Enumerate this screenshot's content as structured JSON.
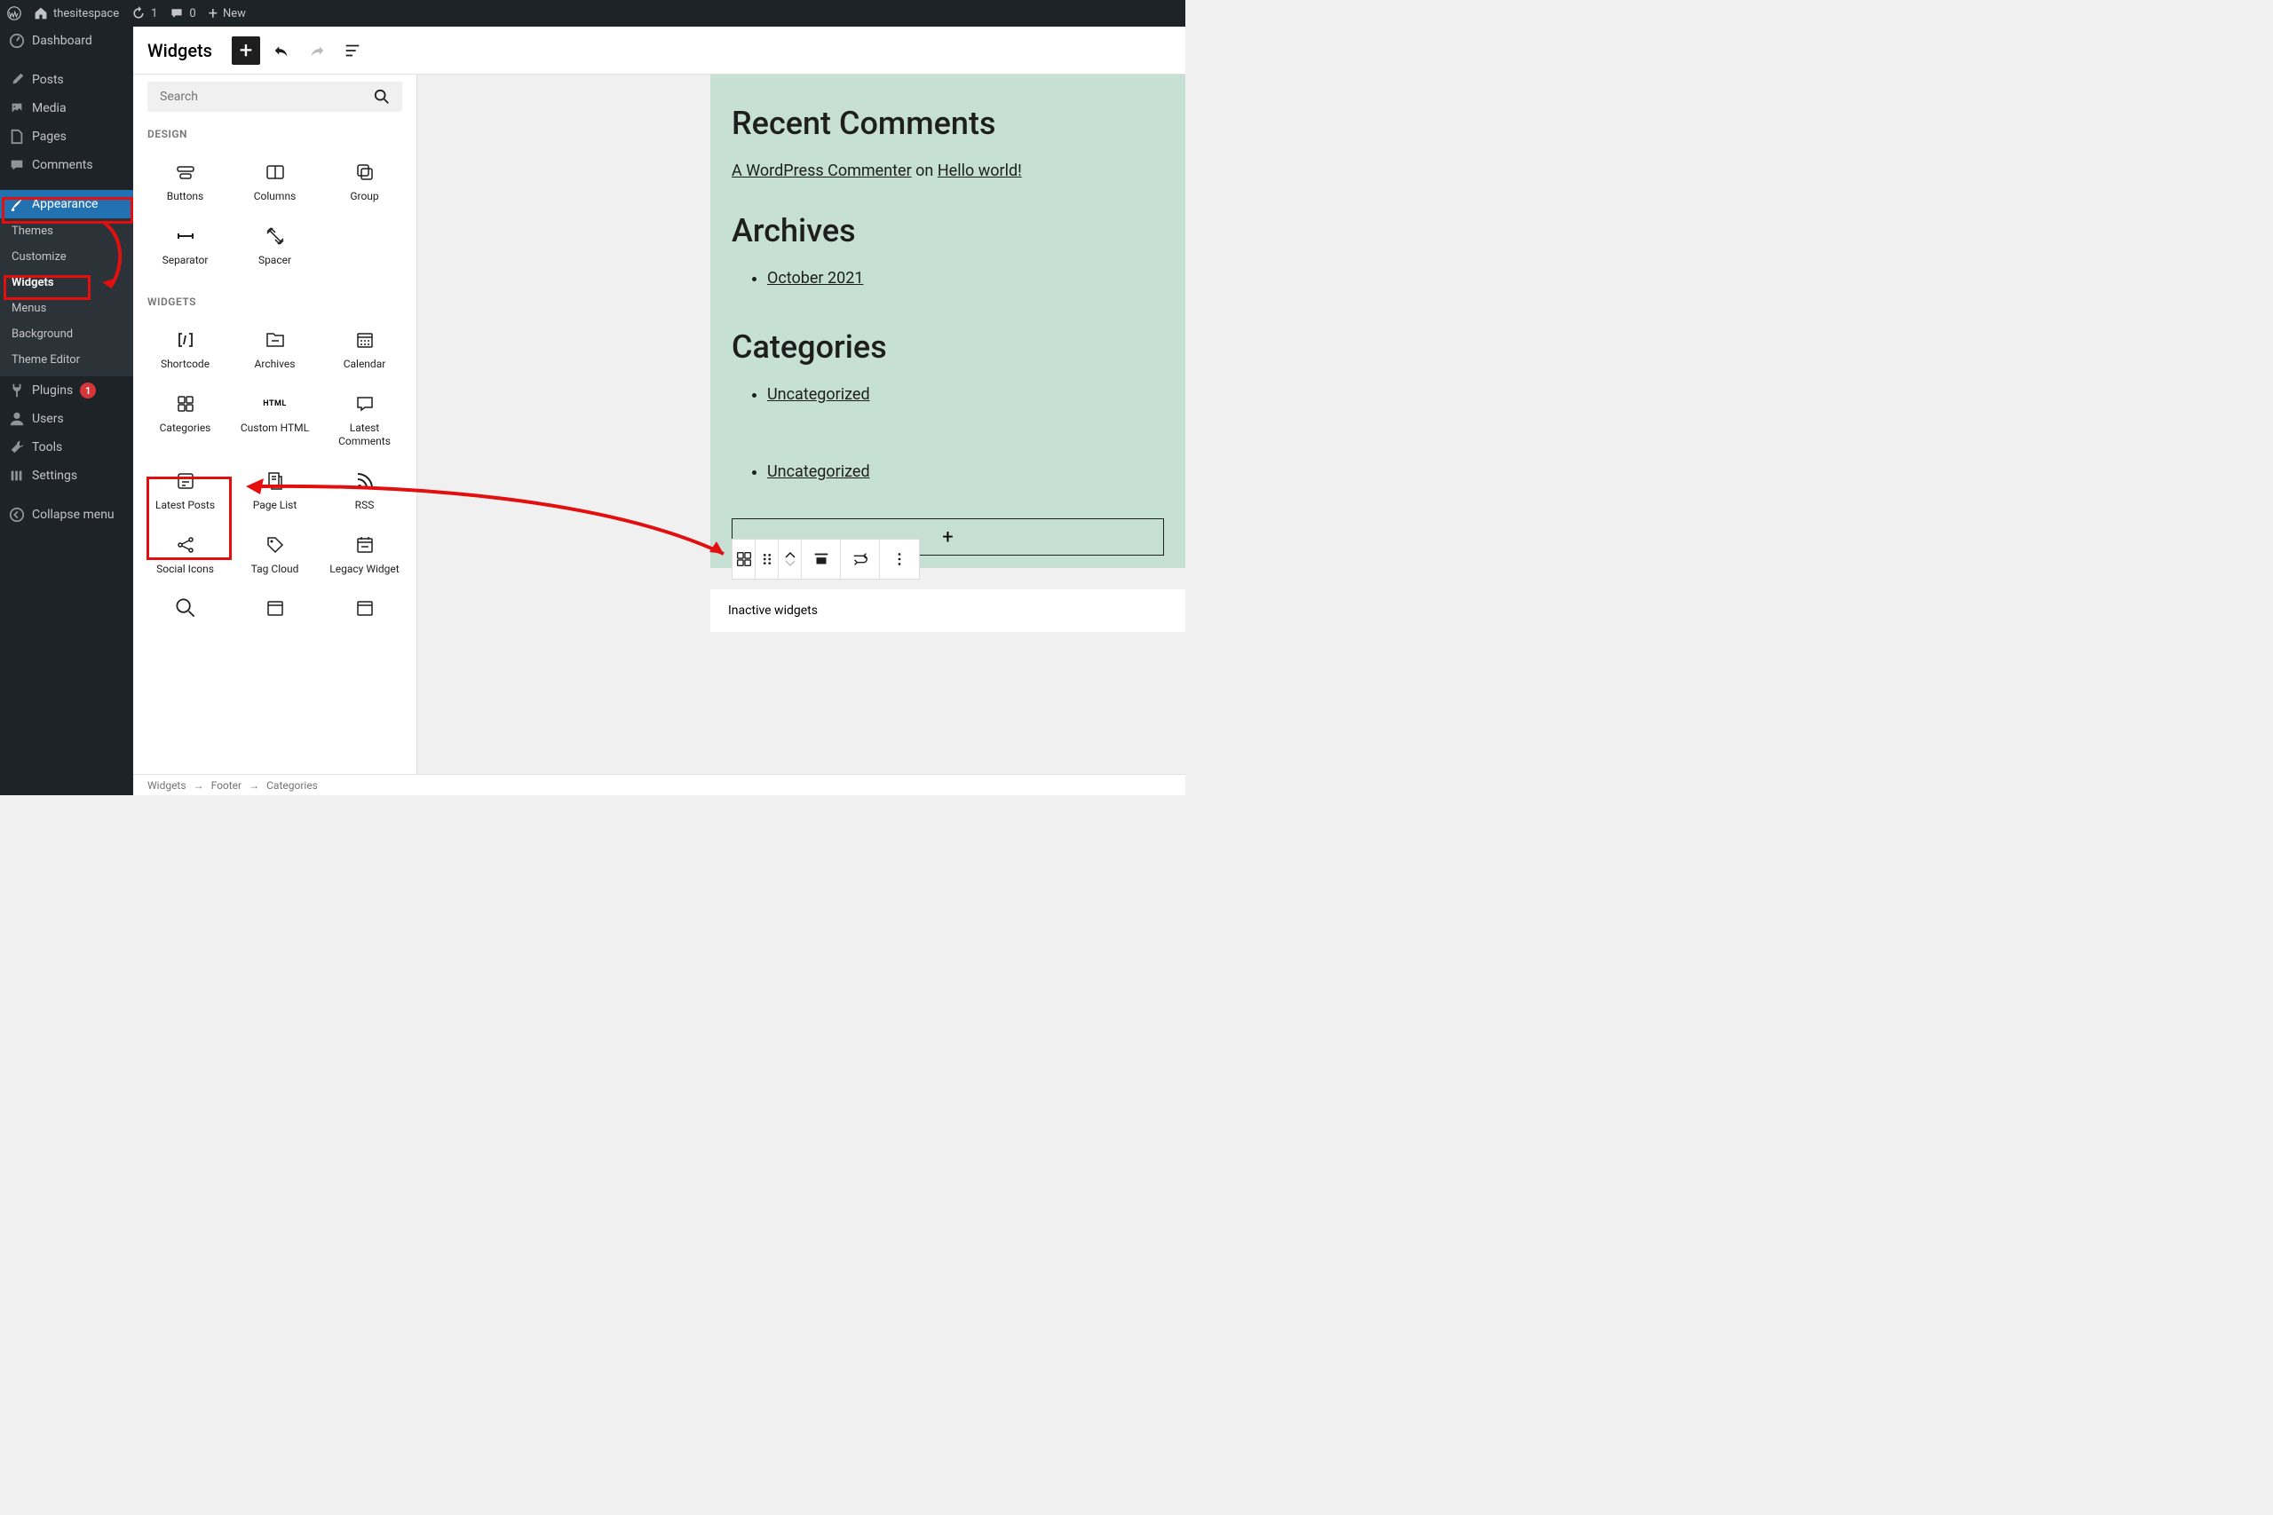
{
  "adminbar": {
    "site": "thesitespace",
    "updates": "1",
    "comments": "0",
    "new": "New"
  },
  "sidebar": {
    "dashboard": "Dashboard",
    "posts": "Posts",
    "media": "Media",
    "pages": "Pages",
    "comments": "Comments",
    "appearance": "Appearance",
    "themes": "Themes",
    "customize": "Customize",
    "widgets": "Widgets",
    "menus": "Menus",
    "background": "Background",
    "theme_editor": "Theme Editor",
    "plugins": "Plugins",
    "plugins_count": "1",
    "users": "Users",
    "tools": "Tools",
    "settings": "Settings",
    "collapse": "Collapse menu"
  },
  "editor": {
    "title": "Widgets"
  },
  "inserter": {
    "search_placeholder": "Search",
    "cat_design": "DESIGN",
    "cat_widgets": "WIDGETS",
    "design": {
      "buttons": "Buttons",
      "columns": "Columns",
      "group": "Group",
      "separator": "Separator",
      "spacer": "Spacer"
    },
    "widgets": {
      "shortcode": "Shortcode",
      "archives": "Archives",
      "calendar": "Calendar",
      "categories": "Categories",
      "custom_html": "Custom HTML",
      "latest_comments": "Latest Comments",
      "latest_posts": "Latest Posts",
      "page_list": "Page List",
      "rss": "RSS",
      "social_icons": "Social Icons",
      "tag_cloud": "Tag Cloud",
      "legacy_widget": "Legacy Widget"
    }
  },
  "preview": {
    "recent_comments": {
      "heading": "Recent Comments",
      "commenter": "A WordPress Commenter",
      "on": " on ",
      "post": "Hello world!"
    },
    "archives": {
      "heading": "Archives",
      "item": "October 2021"
    },
    "categories": {
      "heading": "Categories",
      "item1": "Uncategorized",
      "item2": "Uncategorized"
    },
    "inactive": "Inactive widgets"
  },
  "breadcrumb": {
    "a": "Widgets",
    "b": "Footer",
    "c": "Categories"
  }
}
